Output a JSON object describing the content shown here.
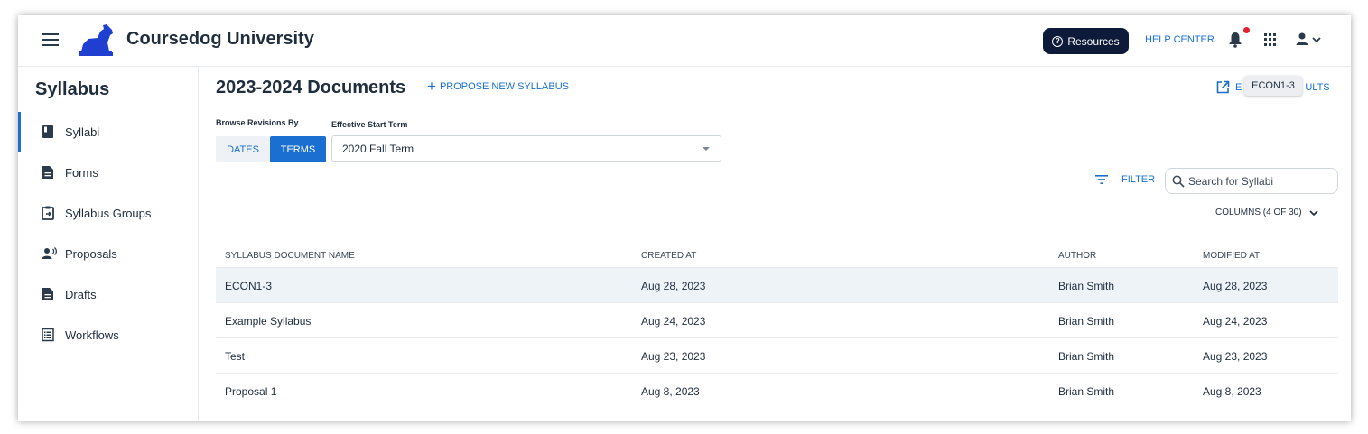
{
  "header": {
    "app_title": "Coursedog University",
    "resources_label": "Resources",
    "help_center_label": "HELP CENTER",
    "icons": [
      "menu-icon",
      "logo-dog",
      "bell-icon",
      "apps-grid-icon",
      "user-icon"
    ],
    "accent_color": "#1a6fd1",
    "notification_dot_color": "#e0202a"
  },
  "sidebar": {
    "title": "Syllabus",
    "items": [
      {
        "label": "Syllabi",
        "icon": "book-icon",
        "active": true
      },
      {
        "label": "Forms",
        "icon": "document-icon"
      },
      {
        "label": "Syllabus Groups",
        "icon": "clipboard-arrow-icon"
      },
      {
        "label": "Proposals",
        "icon": "person-voice-icon"
      },
      {
        "label": "Drafts",
        "icon": "document-icon"
      },
      {
        "label": "Workflows",
        "icon": "list-icon"
      }
    ]
  },
  "main": {
    "title": "2023-2024 Documents",
    "propose_label": "PROPOSE NEW SYLLABUS",
    "export_label_start": "E",
    "export_label_end": "ULTS",
    "tooltip": "ECON1-3",
    "browse_label": "Browse Revisions By",
    "toggle": {
      "dates": "DATES",
      "terms": "TERMS",
      "selected": "TERMS"
    },
    "effective_label": "Effective Start Term",
    "term_value": "2020 Fall Term",
    "filter_label": "FILTER",
    "search_placeholder": "Search for Syllabi",
    "columns_label": "COLUMNS (4 OF 30)"
  },
  "table": {
    "headers": [
      "SYLLABUS DOCUMENT NAME",
      "CREATED AT",
      "AUTHOR",
      "MODIFIED AT"
    ],
    "rows": [
      {
        "name": "ECON1-3",
        "created": "Aug 28, 2023",
        "author": "Brian Smith",
        "modified": "Aug 28, 2023"
      },
      {
        "name": "Example Syllabus",
        "created": "Aug 24, 2023",
        "author": "Brian Smith",
        "modified": "Aug 24, 2023"
      },
      {
        "name": "Test",
        "created": "Aug 23, 2023",
        "author": "Brian Smith",
        "modified": "Aug 23, 2023"
      },
      {
        "name": "Proposal 1",
        "created": "Aug 8, 2023",
        "author": "Brian Smith",
        "modified": "Aug 8, 2023"
      }
    ]
  }
}
